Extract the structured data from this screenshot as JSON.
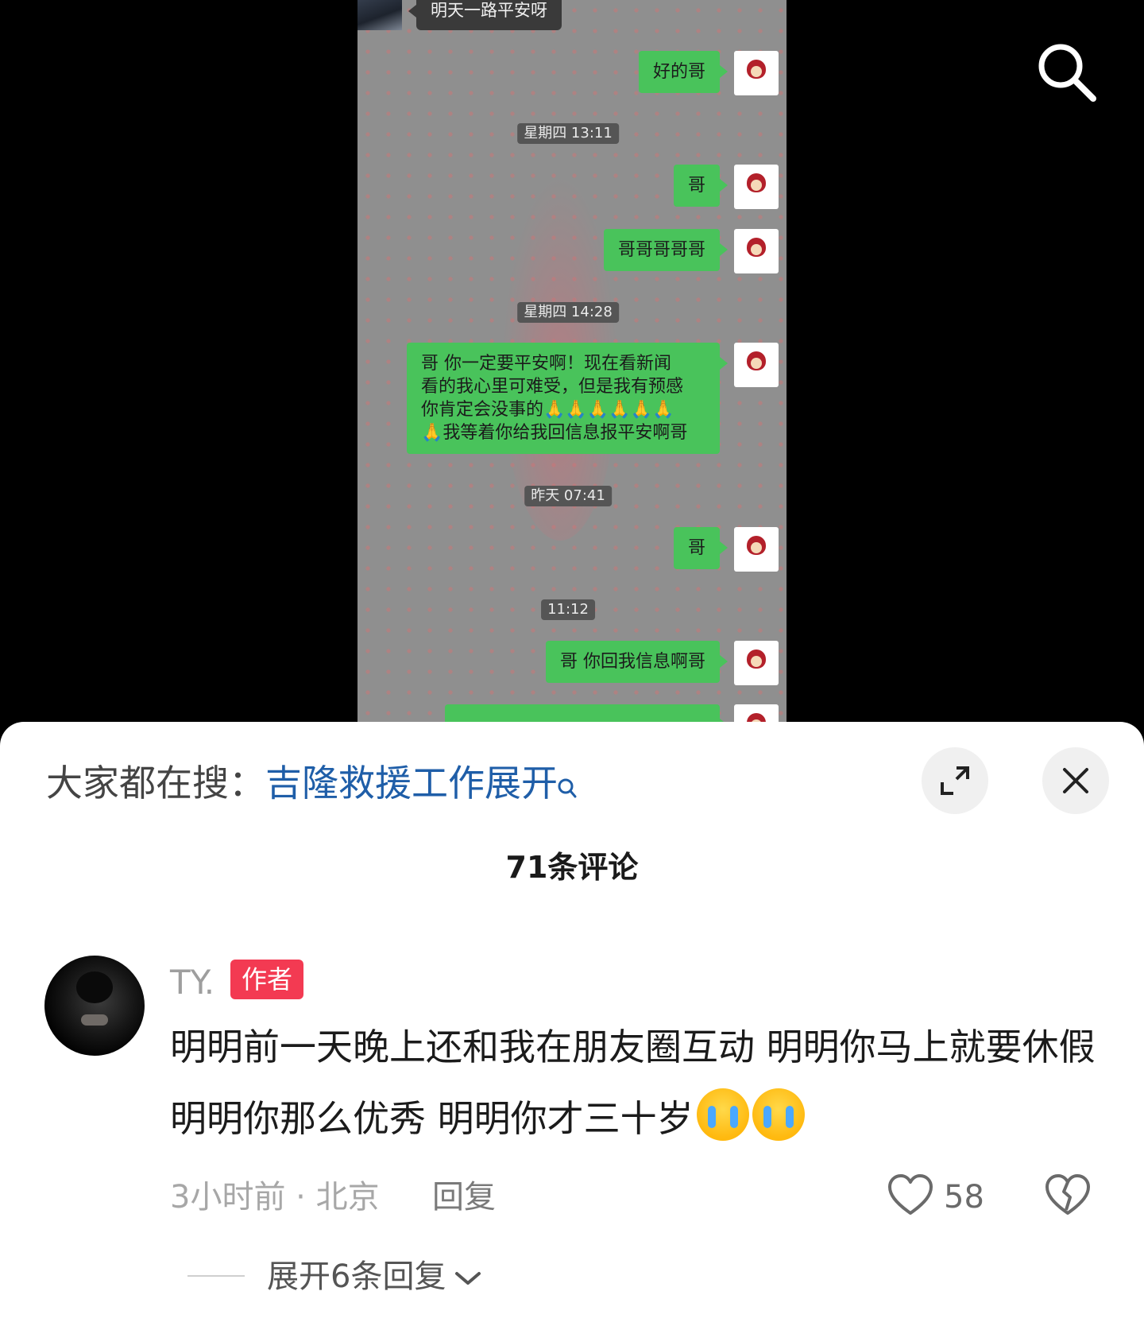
{
  "video": {
    "incoming_message": "明天一路平安呀",
    "messages": [
      {
        "text": "好的哥"
      },
      {
        "text": "哥"
      },
      {
        "text": "哥哥哥哥哥"
      },
      {
        "text": "哥 你一定要平安啊！现在看新闻\n看的我心里可难受，但是我有预感\n你肯定会没事的🙏🙏🙏🙏🙏🙏\n🙏我等着你给我回信息报平安啊哥"
      },
      {
        "text": "哥"
      },
      {
        "text": "哥 你回我信息啊哥"
      }
    ],
    "timestamps": [
      "星期四 13:11",
      "星期四 14:28",
      "昨天 07:41",
      "11:12"
    ]
  },
  "panel": {
    "trending_prefix": "大家都在搜：",
    "trending_topic": "吉隆救援工作展开",
    "comment_count_title": "71条评论"
  },
  "comment": {
    "username": "TY.",
    "author_tag": "作者",
    "text": "明明前一天晚上还和我在朋友圈互动 明明你马上就要休假 明明你那么优秀 明明你才三十岁",
    "time_location": "3小时前 · 北京",
    "reply_label": "回复",
    "like_count": "58",
    "expand_replies": "展开6条回复"
  },
  "icons": {
    "search": "search-icon",
    "fullscreen": "expand-icon",
    "close": "close-icon",
    "like": "heart-icon",
    "dislike": "broken-heart-icon",
    "chevron": "chevron-down-icon",
    "emoji": "loudly-crying-emoji"
  },
  "colors": {
    "bubble_green": "#49c35b",
    "trending_blue": "#1f5ea8",
    "author_tag": "#f33a52"
  }
}
